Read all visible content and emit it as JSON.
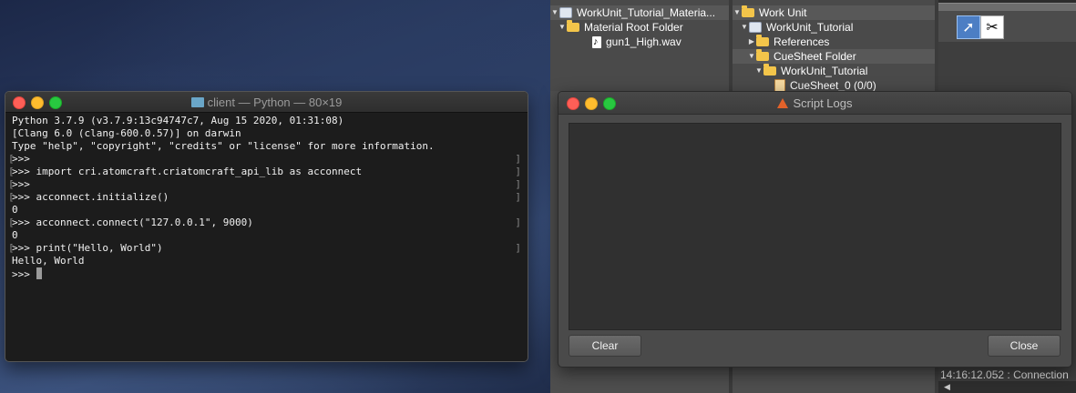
{
  "terminal": {
    "title": "client — Python — 80×19",
    "lines": [
      "Python 3.7.9 (v3.7.9:13c94747c7, Aug 15 2020, 01:31:08)",
      "[Clang 6.0 (clang-600.0.57)] on darwin",
      "Type \"help\", \"copyright\", \"credits\" or \"license\" for more information.",
      ">>>",
      ">>> import cri.atomcraft.criatomcraft_api_lib as acconnect",
      ">>>",
      ">>> acconnect.initialize()",
      "0",
      ">>> acconnect.connect(\"127.0.0.1\", 9000)",
      "0",
      ">>> print(\"Hello, World\")",
      "Hello, World",
      ">>> "
    ]
  },
  "atomcraft": {
    "left_tree": [
      "WorkUnit_Tutorial_Materia...",
      "Material Root Folder",
      "gun1_High.wav"
    ],
    "mid_tree": [
      "Work Unit",
      "WorkUnit_Tutorial",
      "References",
      "CueSheet Folder",
      "WorkUnit_Tutorial",
      "CueSheet_0 (0/0)"
    ],
    "status": "14:16:12.052 : Connection"
  },
  "script_logs": {
    "title": "Script Logs",
    "clear_label": "Clear",
    "close_label": "Close"
  }
}
